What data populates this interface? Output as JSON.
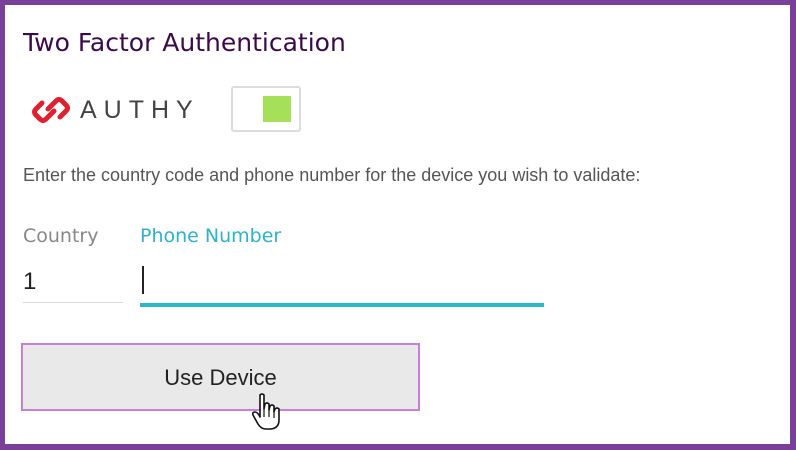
{
  "page": {
    "title": "Two Factor Authentication"
  },
  "provider": {
    "logo_text": "AUTHY",
    "logo_color": "#e0202e",
    "toggle_on": true,
    "toggle_color": "#a6e05a"
  },
  "form": {
    "instructions": "Enter the country code and phone number for the device you wish to validate:",
    "country": {
      "label": "Country",
      "value": "1"
    },
    "phone": {
      "label": "Phone Number",
      "value": ""
    },
    "submit_label": "Use Device"
  },
  "theme": {
    "frame_color": "#7a3f98",
    "accent_color": "#2bb8cc",
    "button_border_color": "#c77fd9"
  },
  "icons": {
    "logo": "authy-logo-icon",
    "cursor": "hand-pointer-cursor-icon"
  }
}
